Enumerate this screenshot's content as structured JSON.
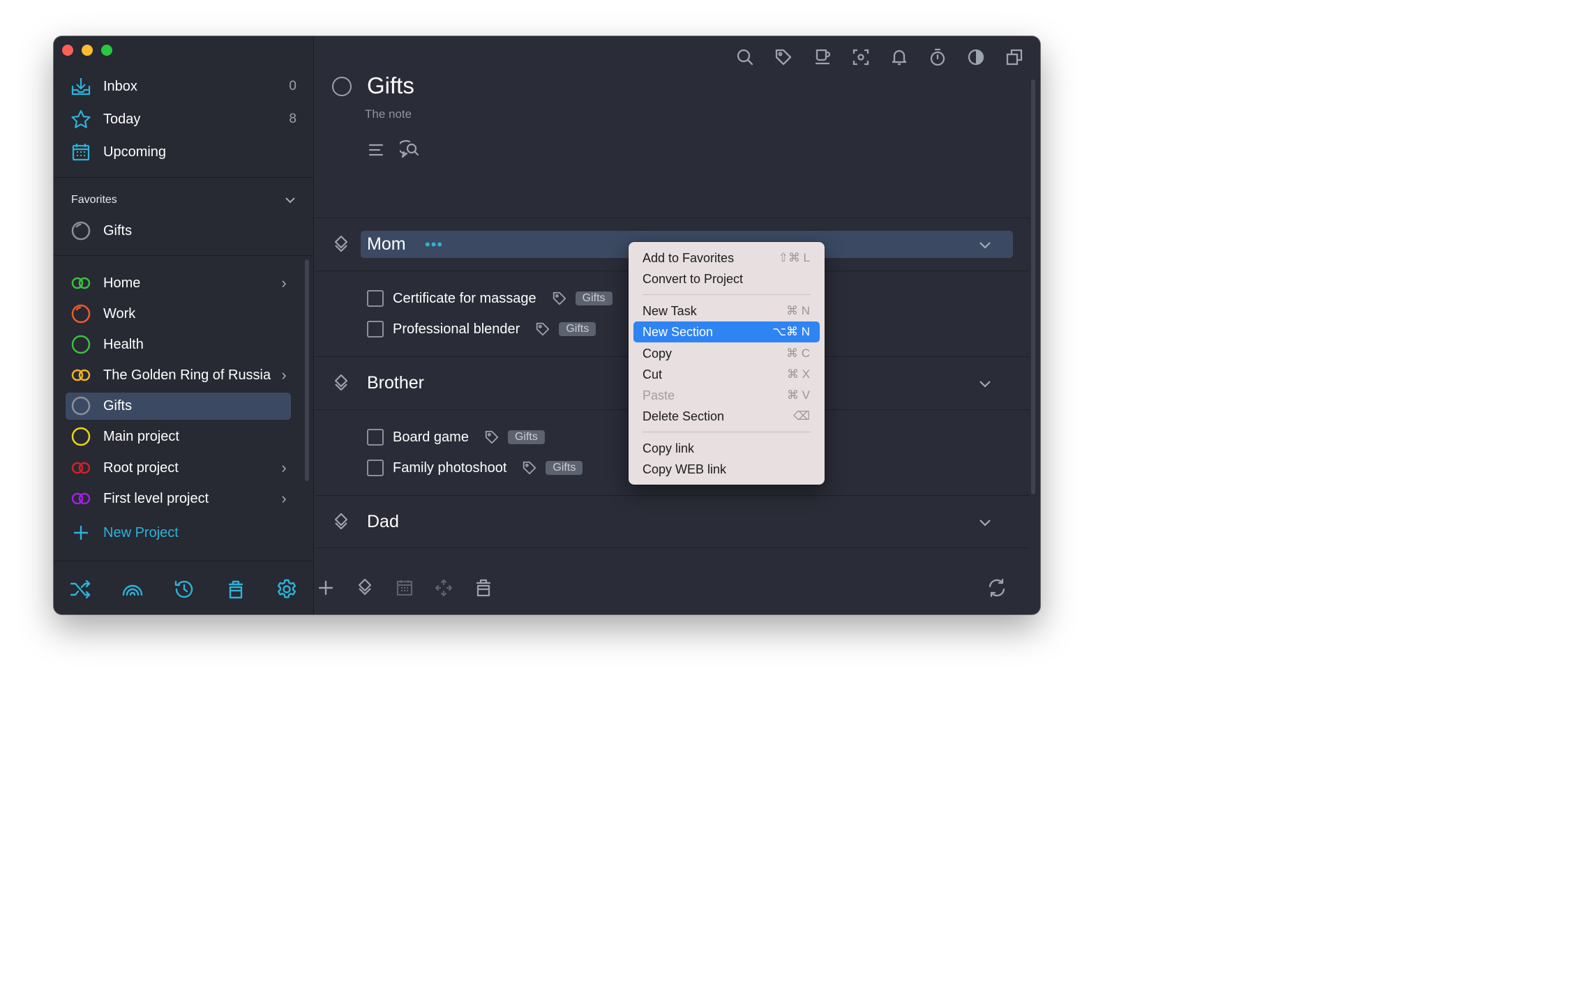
{
  "sidebar": {
    "nav": [
      {
        "label": "Inbox",
        "count": "0",
        "icon": "inbox-icon"
      },
      {
        "label": "Today",
        "count": "8",
        "icon": "star-icon"
      },
      {
        "label": "Upcoming",
        "count": "",
        "icon": "calendar-icon"
      }
    ],
    "favorites_title": "Favorites",
    "favorites": [
      {
        "label": "Gifts",
        "icon": "project-circle-icon"
      }
    ],
    "projects": [
      {
        "label": "Home",
        "color": "#3cc03c",
        "icon": "linked-rings-icon"
      },
      {
        "label": "Work",
        "color": "#f05a28",
        "icon": "progress-circle-icon"
      },
      {
        "label": "Health",
        "color": "#3cc03c",
        "icon": "circle-icon"
      },
      {
        "label": "The Golden Ring of Russia",
        "color": "#f0b41e",
        "icon": "linked-rings-icon"
      },
      {
        "label": "Gifts",
        "color": "#8b909c",
        "icon": "circle-icon"
      },
      {
        "label": "Main project",
        "color": "#ecd80b",
        "icon": "circle-icon"
      },
      {
        "label": "Root project",
        "color": "#d2212a",
        "icon": "linked-rings-icon"
      },
      {
        "label": "First level project",
        "color": "#a11fe6",
        "icon": "linked-rings-icon"
      }
    ],
    "new_project_label": "New Project"
  },
  "main": {
    "title": "Gifts",
    "note": "The note",
    "sections": [
      {
        "title": "Mom",
        "tasks": [
          {
            "name": "Certificate for massage",
            "tag": "Gifts"
          },
          {
            "name": "Professional blender",
            "tag": "Gifts"
          }
        ]
      },
      {
        "title": "Brother",
        "tasks": [
          {
            "name": "Board game",
            "tag": "Gifts"
          },
          {
            "name": "Family photoshoot",
            "tag": "Gifts"
          }
        ]
      },
      {
        "title": "Dad",
        "tasks": []
      }
    ]
  },
  "context_menu": {
    "items": [
      {
        "label": "Add to Favorites",
        "shortcut": "⇧⌘ L"
      },
      {
        "label": "Convert to Project",
        "shortcut": ""
      },
      {
        "label": "New Task",
        "shortcut": "⌘ N"
      },
      {
        "label": "New Section",
        "shortcut": "⌥⌘ N"
      },
      {
        "label": "Copy",
        "shortcut": "⌘ C"
      },
      {
        "label": "Cut",
        "shortcut": "⌘ X"
      },
      {
        "label": "Paste",
        "shortcut": "⌘ V"
      },
      {
        "label": "Delete Section",
        "shortcut": "⌫"
      },
      {
        "label": "Copy link",
        "shortcut": ""
      },
      {
        "label": "Copy WEB link",
        "shortcut": ""
      }
    ]
  },
  "colors": {
    "accent": "#2cb3d9",
    "selection": "#3b4a62",
    "menu_highlight": "#2f84f3"
  }
}
